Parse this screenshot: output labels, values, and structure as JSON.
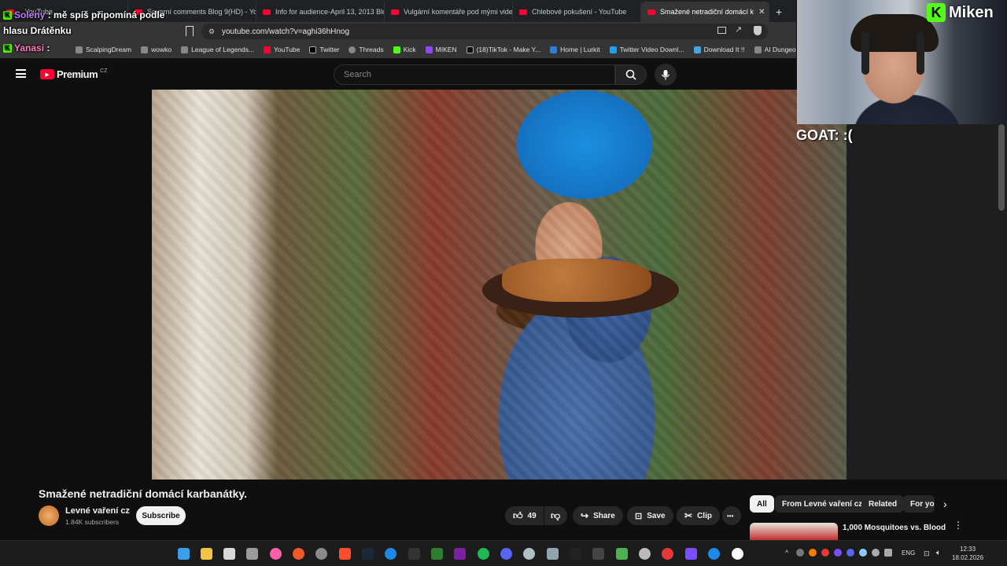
{
  "browser": {
    "tabs": [
      {
        "label": "...YouTube"
      },
      {
        "label": "Severní comments Blog 9(HD) - YouT"
      },
      {
        "label": "Info for audience-April 13, 2013 Blog"
      },
      {
        "label": "Vulgární komentáře pod mými videi("
      },
      {
        "label": "Chlebové pokušení - YouTube"
      },
      {
        "label": "Smažené netradiční domácí k"
      }
    ],
    "active_tab_close": "✕",
    "new_tab": "+",
    "url": "youtube.com/watch?v=aghi36hHnog",
    "bookmarks": [
      "ScalpingDream",
      "wowko",
      "League of Legends...",
      "YouTube",
      "Twitter",
      "Threads",
      "Kick",
      "MIKEN",
      "(18)TikTok - Make Y...",
      "Home | Lurkit",
      "Twitter Video Downl...",
      "Download It !!",
      "AI Dungeon"
    ]
  },
  "youtube": {
    "logo_text": "Premium",
    "logo_region": "CZ",
    "search_placeholder": "Search"
  },
  "video": {
    "title": "Smažené netradiční domácí karbanátky.",
    "channel": "Levné vaření cz",
    "subscribers": "1.84K subscribers",
    "subscribe_label": "Subscribe",
    "likes": "49",
    "share_label": "Share",
    "save_label": "Save",
    "clip_label": "Clip",
    "more_label": "•••"
  },
  "chips": [
    "All",
    "From Levné vaření cz",
    "Related",
    "For yo"
  ],
  "recommendation": {
    "title": "1,000 Mosquitoes vs. Blood"
  },
  "stream_overlay": {
    "streamer": "Miken",
    "caption": "GOAT: :(",
    "chat": [
      {
        "user": "Soleny",
        "message": ": mě spíš připomíná podle"
      },
      {
        "user": "",
        "message": "hlasu Drátěnku"
      },
      {
        "user": "Yanasi",
        "message": ":"
      }
    ]
  },
  "taskbar": {
    "language": "ENG",
    "time": "12:33",
    "date": "18.02.2026"
  },
  "colors": {
    "youtube_red": "#ff0033",
    "kick_green": "#53fc18",
    "background": "#0f0f0f"
  }
}
